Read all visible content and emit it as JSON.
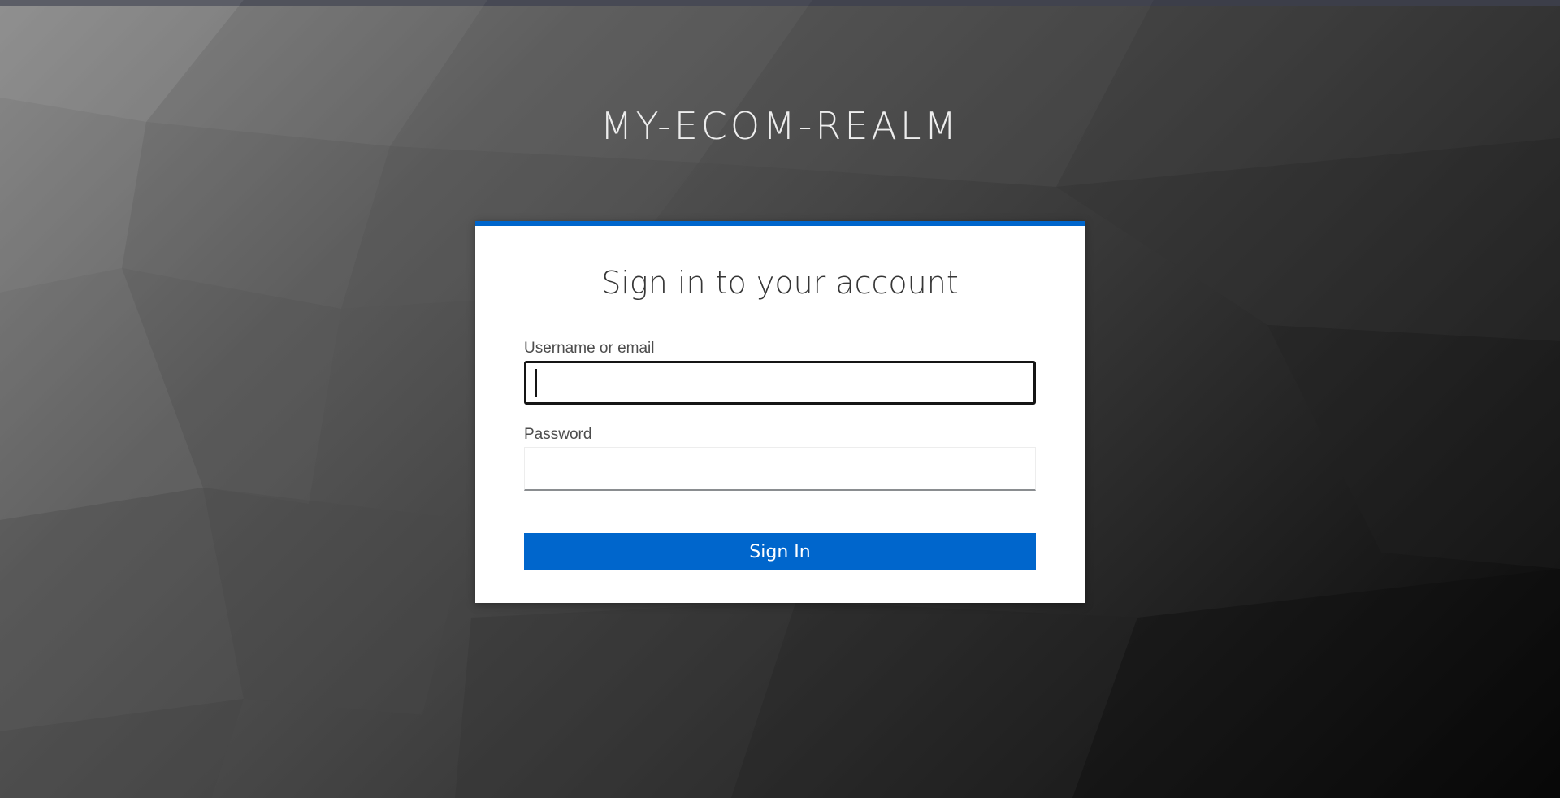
{
  "realm": {
    "title": "MY-ECOM-REALM"
  },
  "login": {
    "heading": "Sign in to your account",
    "username_label": "Username or email",
    "username_value": "",
    "password_label": "Password",
    "password_value": "",
    "submit_label": "Sign In"
  },
  "colors": {
    "accent": "#0066cc",
    "top_bar": "#393c4b",
    "card_background": "#ffffff",
    "text_dark": "#363636"
  }
}
